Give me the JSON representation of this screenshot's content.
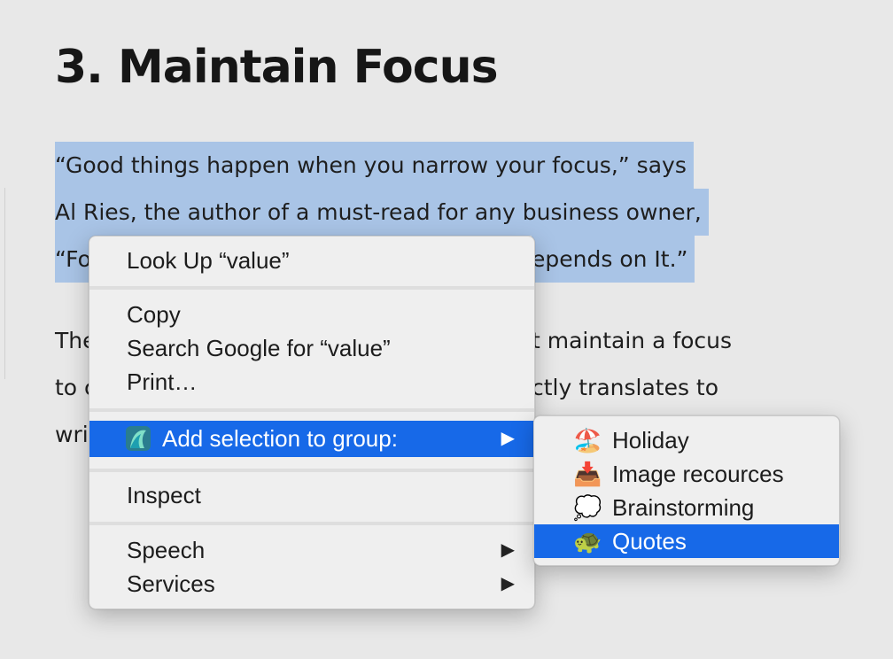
{
  "article": {
    "heading": "3. Maintain Focus",
    "p1": {
      "line1": "“Good things happen when you narrow your focus,” says",
      "line2": "Al Ries, the author of a must-read for any business owner,",
      "line3_left": "“Fo",
      "line3_right": "epends on It.”"
    },
    "p2": {
      "line1_left": "The",
      "line1_right": "t maintain a focus",
      "line2_left": "to c",
      "line2_right": "ctly translates to",
      "line3_left": "wri"
    }
  },
  "context_menu": {
    "look_up": "Look Up “value”",
    "copy": "Copy",
    "search_google": "Search Google for “value”",
    "print": "Print…",
    "add_to_group": "Add selection to group:",
    "inspect": "Inspect",
    "speech": "Speech",
    "services": "Services",
    "submenu_arrow": "▶",
    "app_icon": "app-icon"
  },
  "group_submenu": {
    "items": [
      {
        "emoji": "🏖️",
        "label": "Holiday",
        "icon": "beach-umbrella-icon"
      },
      {
        "emoji": "📥",
        "label": "Image recources",
        "icon": "inbox-tray-icon"
      },
      {
        "emoji": "💭",
        "label": "Brainstorming",
        "icon": "thought-balloon-icon"
      },
      {
        "emoji": "🐢",
        "label": "Quotes",
        "icon": "turtle-icon"
      }
    ],
    "highlighted": "Quotes"
  },
  "colors": {
    "selection": "#a9c4e6",
    "menu_highlight": "#1769e8",
    "menu_bg": "#efefef",
    "page_bg": "#e8e8e8"
  }
}
